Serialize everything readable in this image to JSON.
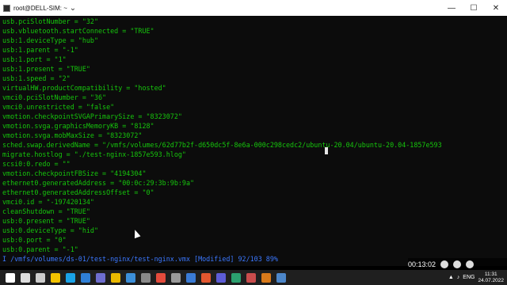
{
  "window": {
    "title": "root@DELL-SIM: ~",
    "icon": "terminal-icon",
    "tab_dropdown": "⌄",
    "controls": [
      "minimize",
      "maximize",
      "close"
    ]
  },
  "terminal": {
    "lines": [
      "usb.pciSlotNumber = \"32\"",
      "usb.vbluetooth.startConnected = \"TRUE\"",
      "usb:1.deviceType = \"hub\"",
      "usb:1.parent = \"-1\"",
      "usb:1.port = \"1\"",
      "usb:1.present = \"TRUE\"",
      "usb:1.speed = \"2\"",
      "virtualHW.productCompatibility = \"hosted\"",
      "vmci0.pciSlotNumber = \"36\"",
      "vmci0.unrestricted = \"false\"",
      "vmotion.checkpointSVGAPrimarySize = \"8323072\"",
      "vmotion.svga.graphicsMemoryKB = \"8128\"",
      "vmotion.svga.mobMaxSize = \"8323072\"",
      "sched.swap.derivedName = \"/vmfs/volumes/62d77b2f-d650dc5f-8e6a-000c298cedc2/ubuntu-20.04/ubuntu-20.04-1857e593",
      "migrate.hostlog = \"./test-nginx-1857e593.hlog\"",
      "scsi0:0.redo = \"\"",
      "vmotion.checkpointFBSize = \"4194304\"",
      "ethernet0.generatedAddress = \"00:0c:29:3b:9b:9a\"",
      "ethernet0.generatedAddressOffset = \"0\"",
      "vmci0.id = \"-197420134\"",
      "cleanShutdown = \"TRUE\"",
      "usb:0.present = \"TRUE\"",
      "usb:0.deviceType = \"hid\"",
      "usb:0.port = \"0\"",
      "usb:0.parent = \"-1\""
    ],
    "status_line": "I /vmfs/volumes/ds-01/test-nginx/test-nginx.vmx [Modified] 92/103 89%"
  },
  "overlay": {
    "timer": "00:13:02"
  },
  "taskbar": {
    "apps": [
      {
        "name": "start-icon",
        "color": "#ffffff"
      },
      {
        "name": "search-icon",
        "color": "#dddddd"
      },
      {
        "name": "task-view-icon",
        "color": "#cccccc"
      },
      {
        "name": "file-explorer-icon",
        "color": "#f2c200"
      },
      {
        "name": "edge-icon",
        "color": "#1aa3e8"
      },
      {
        "name": "mail-icon",
        "color": "#2f7fd6"
      },
      {
        "name": "store-icon",
        "color": "#6e6ecf"
      },
      {
        "name": "folder-icon",
        "color": "#e9b800"
      },
      {
        "name": "photos-icon",
        "color": "#3c8fd9"
      },
      {
        "name": "vmware-icon",
        "color": "#8a8a8a"
      },
      {
        "name": "chrome-icon",
        "color": "#e44b3c"
      },
      {
        "name": "settings-icon",
        "color": "#999999"
      },
      {
        "name": "app-icon-1",
        "color": "#3a7bd5"
      },
      {
        "name": "terminal-app-icon",
        "color": "#e3572f"
      },
      {
        "name": "app-icon-2",
        "color": "#5c5cd6"
      },
      {
        "name": "app-icon-3",
        "color": "#2ba06f"
      },
      {
        "name": "app-icon-4",
        "color": "#c94c4c"
      },
      {
        "name": "app-icon-5",
        "color": "#d97a1a"
      },
      {
        "name": "app-icon-6",
        "color": "#4c86c9"
      }
    ],
    "tray": {
      "language": "ENG",
      "time": "11:31",
      "date": "24.07.2022"
    }
  }
}
